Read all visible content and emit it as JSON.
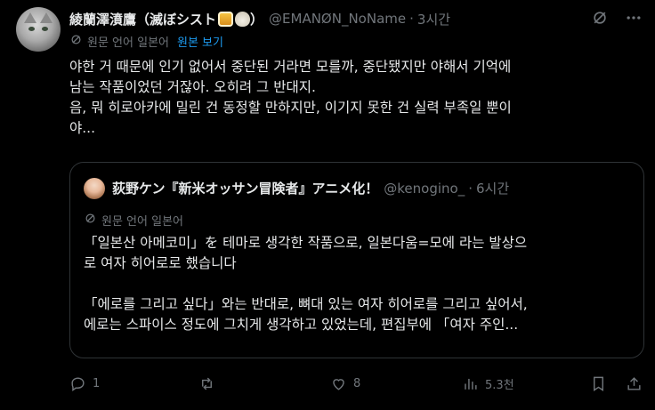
{
  "post": {
    "display_name": "綾蘭澤濆鷹（滅ぼシスト",
    "name_close": "）",
    "handle": "@EMANØN_NoName",
    "separator": "·",
    "time": "3시간",
    "translate_label": "원문 언어 일본어",
    "show_original": "원본 보기",
    "text_lines": [
      "야한 거 때문에 인기 없어서 중단된 거라면 모를까, 중단됐지만 야해서 기억에",
      "남는 작품이었던 거잖아. 오히려 그 반대지.",
      "음, 뭐 히로아카에 밀린 건 동정할 만하지만, 이기지 못한 건 실력 부족일 뿐이",
      "야..."
    ]
  },
  "quote": {
    "display_name": "荻野ケン『新米オッサン冒険者』アニメ化！",
    "handle": "@kenogino_",
    "separator": "·",
    "time": "6시간",
    "translate_label": "원문 언어 일본어",
    "text_lines": [
      "「일본산 아메코미」を 테마로 생각한 작품으로, 일본다움=모에 라는 발상으",
      "로 여자 히어로로 했습니다",
      "",
      "「에로를 그리고 싶다」와는 반대로, 뼈대 있는 여자 히어로를 그리고 싶어서,",
      "에로는 스파이스 정도에 그치게 생각하고 있었는데, 편집부에 「여자 주인..."
    ]
  },
  "actions": {
    "reply_count": "1",
    "retweet_count": "",
    "like_count": "8",
    "view_count": "5.3천"
  },
  "colors": {
    "background": "#000000",
    "text": "#e7e9ea",
    "muted": "#71767b",
    "link": "#1d9bf0",
    "border": "#2f3336"
  }
}
